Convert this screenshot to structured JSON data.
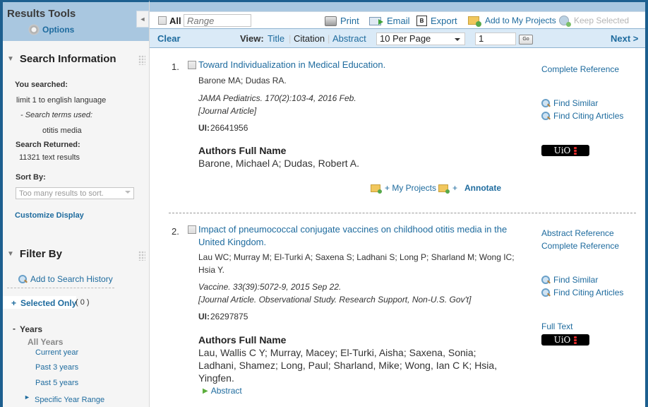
{
  "sidebar": {
    "results_tools": {
      "title": "Results Tools",
      "options_label": "Options",
      "collapse_icon": "◄"
    },
    "search_info": {
      "title": "Search Information",
      "you_searched_label": "You searched:",
      "query": "limit 1 to english language",
      "terms_label": "- Search terms used:",
      "terms": "otitis media",
      "returned_label": "Search Returned:",
      "returned_value": "11321 text results",
      "sort_label": "Sort By:",
      "sort_value": "Too many results to sort.",
      "customize_label": "Customize Display"
    },
    "filter_by": {
      "title": "Filter By",
      "add_history_label": "Add to Search History",
      "selected_only_prefix": "+",
      "selected_only_label": "Selected Only",
      "selected_only_count": "( 0 )",
      "years_prefix": "-",
      "years_label": "Years",
      "year_options": [
        "All Years",
        "Current year",
        "Past 3 years",
        "Past 5 years"
      ],
      "specific_range_label": "Specific Year Range"
    }
  },
  "toolbar": {
    "all_label": "All",
    "range_placeholder": "Range",
    "print_label": "Print",
    "email_label": "Email",
    "export_label": "Export",
    "export_icon_text": "B",
    "add_projects_label": "Add to My Projects",
    "keep_selected_label": "Keep Selected",
    "clear_label": "Clear",
    "view_label": "View:",
    "view_options": [
      "Title",
      "Citation",
      "Abstract"
    ],
    "per_page_value": "10 Per Page",
    "page_value": "1",
    "go_label": "Go",
    "next_label": "Next >"
  },
  "results": [
    {
      "num": "1.",
      "title_lines": [
        "Toward Individualization in Medical Education."
      ],
      "authors_lines": [
        "Barone MA; Dudas RA."
      ],
      "source": "JAMA Pediatrics. 170(2):103-4, 2016 Feb.",
      "pub_type": "[Journal Article]",
      "ui_label": "UI:",
      "ui_value": "26641956",
      "afn_label": "Authors Full Name",
      "afn_lines": [
        "Barone, Michael A; Dudas, Robert A."
      ],
      "links": [
        "Complete Reference"
      ],
      "find_similar": "Find Similar",
      "find_citing": "Find Citing Articles",
      "uio_label": "UiO",
      "my_projects_label": "+ My Projects",
      "annotate_prefix": "+",
      "annotate_label": "Annotate"
    },
    {
      "num": "2.",
      "title_lines": [
        "Impact of pneumococcal conjugate vaccines on childhood otitis media in the",
        "United Kingdom."
      ],
      "authors_lines": [
        "Lau WC; Murray M; El-Turki A; Saxena S; Ladhani S; Long P; Sharland M; Wong IC;",
        "Hsia Y."
      ],
      "source": "Vaccine. 33(39):5072-9, 2015 Sep 22.",
      "pub_type": "[Journal Article. Observational Study. Research Support, Non-U.S. Gov't]",
      "ui_label": "UI:",
      "ui_value": "26297875",
      "afn_label": "Authors Full Name",
      "afn_lines": [
        "Lau, Wallis C Y; Murray, Macey; El-Turki, Aisha; Saxena, Sonia;",
        "Ladhani, Shamez; Long, Paul; Sharland, Mike; Wong, Ian C K; Hsia,",
        "Yingfen."
      ],
      "abstract_label": "Abstract",
      "links": [
        "Abstract Reference",
        "Complete Reference"
      ],
      "find_similar": "Find Similar",
      "find_citing": "Find Citing Articles",
      "full_text_label": "Full Text",
      "uio_label": "UiO"
    }
  ],
  "colors": {
    "accent": "#1e6b9e",
    "frame": "#1d5f8f",
    "header_bg": "#a9c7e0",
    "toolbar_bg": "#daeaf7"
  }
}
